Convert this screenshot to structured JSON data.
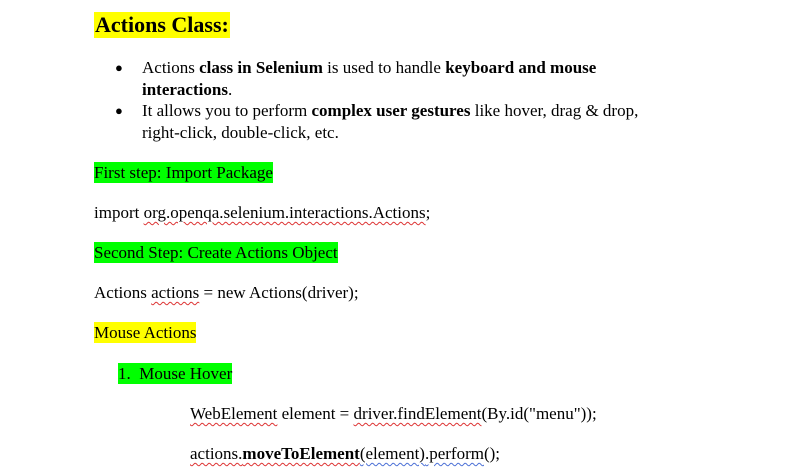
{
  "title": "Actions Class:",
  "bullets": {
    "b1": {
      "pre": "Actions ",
      "bold1": "class in Selenium",
      "mid": " is used to handle ",
      "bold2": "keyboard and mouse",
      "bold3": "interactions",
      "end": "."
    },
    "b2": {
      "pre": "It allows you to perform ",
      "bold1": "complex user gestures",
      "mid": " like hover, drag & drop,",
      "line2": "right-click, double-click, etc."
    }
  },
  "step1": "First step: Import Package",
  "import_line": {
    "pre": "import ",
    "pkg": "org.openqa.selenium.interactions.Actions",
    "end": ";"
  },
  "step2": "Second Step: Create Actions Object",
  "create_line": {
    "pre": "Actions ",
    "var": "actions",
    "end": " = new Actions(driver);"
  },
  "mouse_actions": "Mouse Actions",
  "item1": {
    "number": "1.",
    "label": "Mouse Hover"
  },
  "code1": {
    "type": "WebElement",
    "mid": " element = ",
    "call": "driver.findElement",
    "end": "(By.id(\"menu\"));"
  },
  "code2": {
    "obj": "actions.",
    "method": "moveToElement",
    "mid": "(element)",
    "perform": ".perform",
    "end": "();"
  }
}
